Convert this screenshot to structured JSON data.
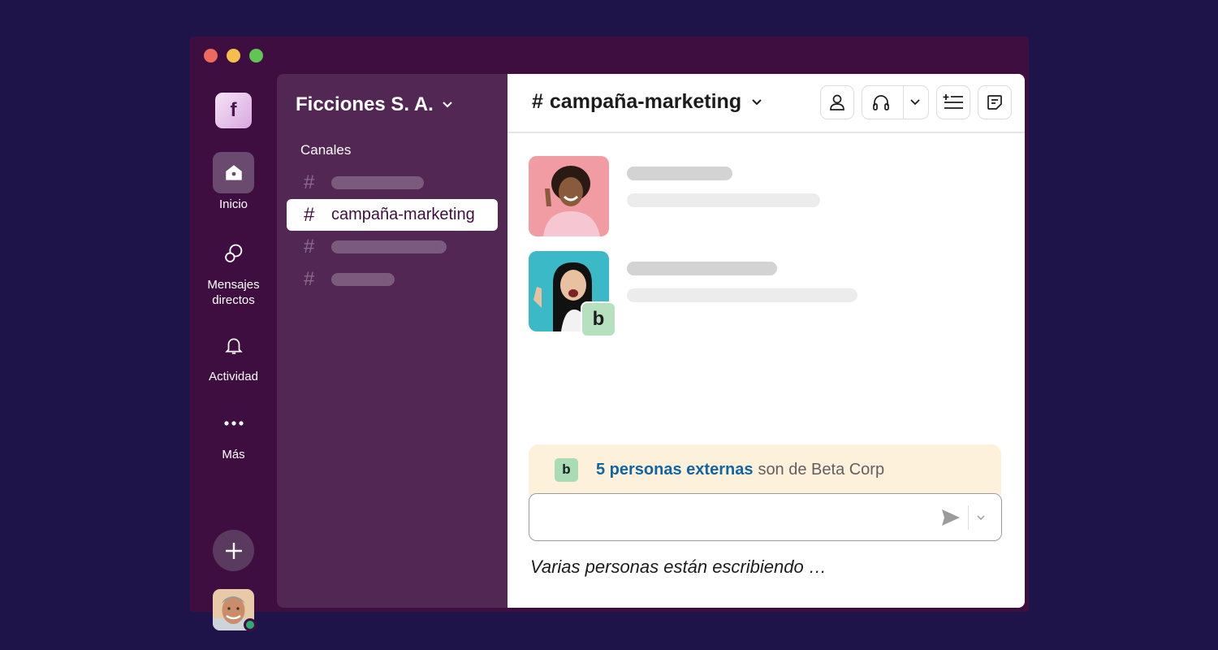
{
  "workspace": {
    "initial": "f",
    "name": "Ficciones S. A."
  },
  "rail": {
    "home_label": "Inicio",
    "dms_label": "Mensajes directos",
    "activity_label": "Actividad",
    "more_label": "Más"
  },
  "sidebar": {
    "section_title": "Canales",
    "selected_channel": "campaña-marketing"
  },
  "channel": {
    "title": "campaña-marketing"
  },
  "external_badge": "b",
  "external_notice": {
    "link_text": "5 personas externas",
    "rest_text": "son de Beta Corp"
  },
  "typing_indicator": "Varias personas están escribiendo …",
  "colors": {
    "background": "#1f1449",
    "window": "#3f0e40",
    "sidebar": "#532753",
    "link": "#1264a3",
    "presence": "#2bac76"
  }
}
